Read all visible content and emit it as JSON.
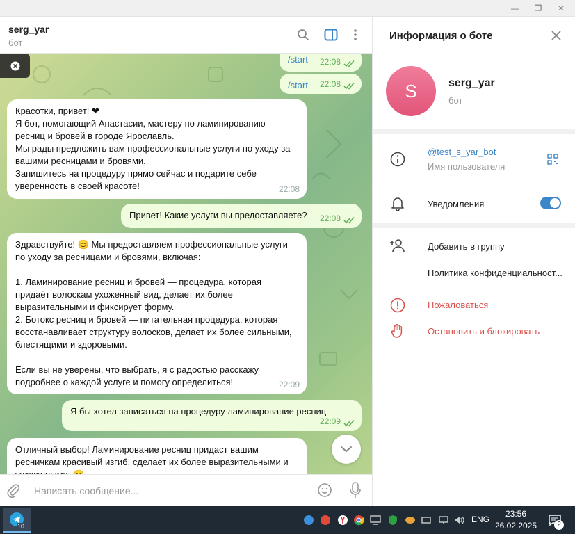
{
  "window": {
    "minimize_glyph": "—",
    "restore_glyph": "❐",
    "close_glyph": "✕"
  },
  "chat": {
    "title": "serg_yar",
    "subtitle": "бот",
    "header_icons": [
      "search-icon",
      "sidebar-toggle-icon",
      "more-icon"
    ]
  },
  "messages": [
    {
      "direction": "out",
      "text": "/start",
      "time": "22:08",
      "is_command": true
    },
    {
      "direction": "out",
      "text": "/start",
      "time": "22:08",
      "is_command": true
    },
    {
      "direction": "in",
      "text": "Красотки, привет! ❤\nЯ бот, помогающий Анастасии, мастеру по ламинированию\nресниц и бровей в городе Ярославль.\nМы рады предложить вам профессиональные услуги по уходу за\nвашими ресницами и бровями.\nЗапишитесь на процедуру прямо сейчас и подарите себе\nуверенность в своей красоте!",
      "time": "22:08"
    },
    {
      "direction": "out",
      "text": "Привет! Какие услуги вы предоставляете?",
      "time": "22:08"
    },
    {
      "direction": "in",
      "text": "Здравствуйте! 😊 Мы предоставляем профессиональные услуги\nпо уходу за ресницами и бровями, включая:\n\n1. Ламинирование ресниц и бровей — процедура, которая\nпридаёт волоскам ухоженный вид, делает их более\nвыразительными и фиксирует форму.\n2. Ботокс ресниц и бровей — питательная процедура, которая\nвосстанавливает структуру волосков, делает их более сильными,\nблестящими и здоровыми.\n\nЕсли вы не уверены, что выбрать, я с радостью расскажу\nподробнее о каждой услуге и помогу определиться!",
      "time": "22:09"
    },
    {
      "direction": "out",
      "text": "Я бы хотел записаться на процедуру ламинирование ресниц",
      "time": "22:09"
    },
    {
      "direction": "in",
      "text": "Отличный выбор! Ламинирование ресниц придаст вашим\nресничкам красивый изгиб, сделает их более выразительными и\nухоженными. 😊",
      "time": ""
    }
  ],
  "composer": {
    "placeholder": "Написать сообщение..."
  },
  "panel": {
    "title": "Информация о боте",
    "avatar_letter": "S",
    "name": "serg_yar",
    "status": "бот",
    "username": "@test_s_yar_bot",
    "username_label": "Имя пользователя",
    "notifications_label": "Уведомления",
    "notifications_on": true,
    "add_to_group": "Добавить в группу",
    "privacy_policy": "Политика конфиденциальност...",
    "report": "Пожаловаться",
    "stop_block": "Остановить и блокировать"
  },
  "taskbar": {
    "app_badge": "10",
    "lang": "ENG",
    "time": "23:56",
    "date": "26.02.2025",
    "notification_count": "2"
  },
  "colors": {
    "accent": "#3a86c8",
    "outgoing_bubble": "#effdde",
    "danger": "#d9534f",
    "avatar": "#e8607f"
  }
}
